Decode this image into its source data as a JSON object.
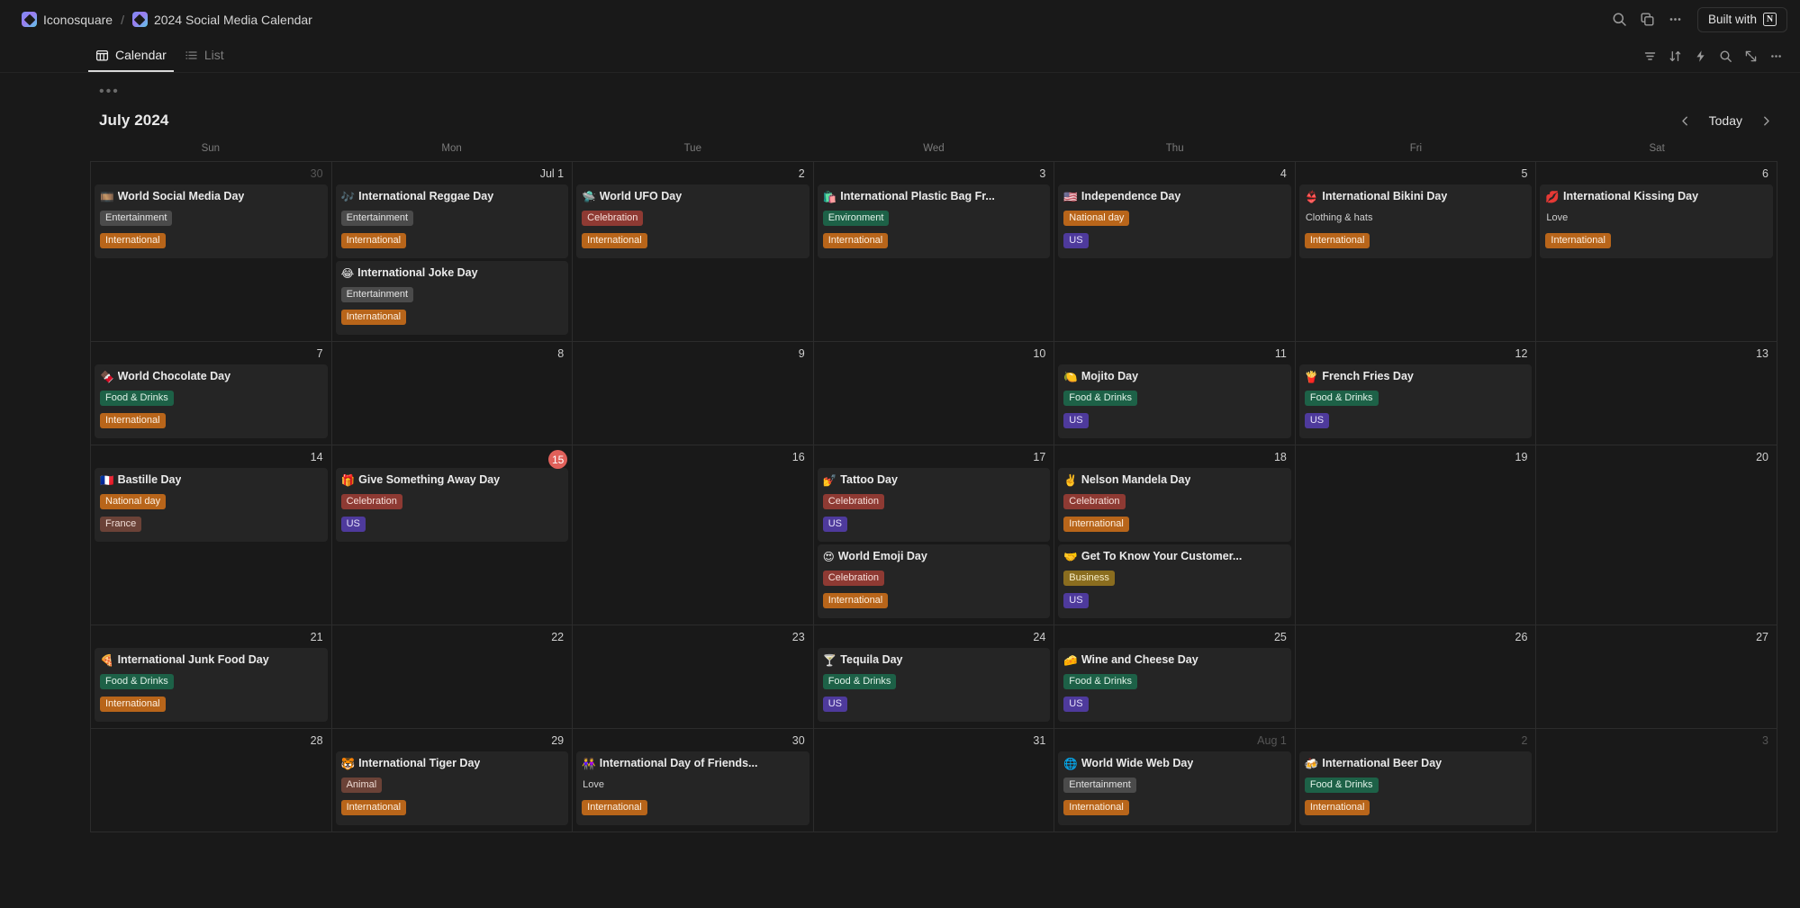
{
  "topbar": {
    "breadcrumb": [
      {
        "label": "Iconosquare",
        "icon": "iconosquare-logo"
      },
      {
        "label": "2024 Social Media Calendar",
        "icon": "iconosquare-logo"
      }
    ],
    "separator": "/",
    "actions": [
      {
        "name": "search-icon",
        "label": "Search"
      },
      {
        "name": "duplicate-icon",
        "label": "Duplicate"
      },
      {
        "name": "more-options-icon",
        "label": "More"
      }
    ],
    "built_with_label": "Built with",
    "built_with_brand": "N"
  },
  "view_tabs": [
    {
      "label": "Calendar",
      "icon": "calendar-icon",
      "active": true
    },
    {
      "label": "List",
      "icon": "list-icon",
      "active": false
    }
  ],
  "view_toolbar": [
    {
      "name": "filter-icon"
    },
    {
      "name": "sort-icon"
    },
    {
      "name": "automation-icon"
    },
    {
      "name": "search-icon"
    },
    {
      "name": "collapse-icon"
    },
    {
      "name": "more-options-icon"
    }
  ],
  "block_menu": "•••",
  "calendar": {
    "month_title": "July 2024",
    "today_label": "Today",
    "prev_label": "‹",
    "next_label": "›",
    "weekdays": [
      "Sun",
      "Mon",
      "Tue",
      "Wed",
      "Thu",
      "Fri",
      "Sat"
    ],
    "weeks": [
      [
        {
          "num": "30",
          "out": true,
          "events": [
            {
              "emoji": "🎞️",
              "title": "World Social Media Day",
              "tags": [
                {
                  "label": "Entertainment",
                  "color": "gray"
                },
                {
                  "label": "International",
                  "color": "orange"
                }
              ]
            }
          ]
        },
        {
          "num": "Jul 1",
          "out": false,
          "events": [
            {
              "emoji": "🎶",
              "title": "International Reggae Day",
              "tags": [
                {
                  "label": "Entertainment",
                  "color": "gray"
                },
                {
                  "label": "International",
                  "color": "orange"
                }
              ]
            },
            {
              "emoji": "😂",
              "title": "International Joke Day",
              "tags": [
                {
                  "label": "Entertainment",
                  "color": "gray"
                },
                {
                  "label": "International",
                  "color": "orange"
                }
              ]
            }
          ]
        },
        {
          "num": "2",
          "out": false,
          "events": [
            {
              "emoji": "🛸",
              "title": "World UFO Day",
              "tags": [
                {
                  "label": "Celebration",
                  "color": "red"
                },
                {
                  "label": "International",
                  "color": "orange"
                }
              ]
            }
          ]
        },
        {
          "num": "3",
          "out": false,
          "events": [
            {
              "emoji": "🛍️",
              "title": "International Plastic Bag Fr...",
              "tags": [
                {
                  "label": "Environment",
                  "color": "green"
                },
                {
                  "label": "International",
                  "color": "orange"
                }
              ]
            }
          ]
        },
        {
          "num": "4",
          "out": false,
          "events": [
            {
              "emoji": "🇺🇸",
              "title": "Independence Day",
              "tags": [
                {
                  "label": "National day",
                  "color": "orange"
                },
                {
                  "label": "US",
                  "color": "purple"
                }
              ]
            }
          ]
        },
        {
          "num": "5",
          "out": false,
          "events": [
            {
              "emoji": "👙",
              "title": "International Bikini Day",
              "tags": [
                {
                  "label": "Clothing & hats",
                  "color": "default"
                },
                {
                  "label": "International",
                  "color": "orange"
                }
              ]
            }
          ]
        },
        {
          "num": "6",
          "out": false,
          "events": [
            {
              "emoji": "💋",
              "title": "International Kissing Day",
              "tags": [
                {
                  "label": "Love",
                  "color": "default"
                },
                {
                  "label": "International",
                  "color": "orange"
                }
              ]
            }
          ]
        }
      ],
      [
        {
          "num": "7",
          "out": false,
          "events": [
            {
              "emoji": "🍫",
              "title": "World Chocolate Day",
              "tags": [
                {
                  "label": "Food & Drinks",
                  "color": "green"
                },
                {
                  "label": "International",
                  "color": "orange"
                }
              ]
            }
          ]
        },
        {
          "num": "8",
          "out": false,
          "events": []
        },
        {
          "num": "9",
          "out": false,
          "events": []
        },
        {
          "num": "10",
          "out": false,
          "events": []
        },
        {
          "num": "11",
          "out": false,
          "events": [
            {
              "emoji": "🍋",
              "title": "Mojito Day",
              "tags": [
                {
                  "label": "Food & Drinks",
                  "color": "green"
                },
                {
                  "label": "US",
                  "color": "purple"
                }
              ]
            }
          ]
        },
        {
          "num": "12",
          "out": false,
          "events": [
            {
              "emoji": "🍟",
              "title": "French Fries Day",
              "tags": [
                {
                  "label": "Food & Drinks",
                  "color": "green"
                },
                {
                  "label": "US",
                  "color": "purple"
                }
              ]
            }
          ]
        },
        {
          "num": "13",
          "out": false,
          "events": []
        }
      ],
      [
        {
          "num": "14",
          "out": false,
          "events": [
            {
              "emoji": "🇫🇷",
              "title": "Bastille Day",
              "tags": [
                {
                  "label": "National day",
                  "color": "orange"
                },
                {
                  "label": "France",
                  "color": "brown"
                }
              ]
            }
          ]
        },
        {
          "num": "15",
          "out": false,
          "today": true,
          "events": [
            {
              "emoji": "🎁",
              "title": "Give Something Away Day",
              "tags": [
                {
                  "label": "Celebration",
                  "color": "red"
                },
                {
                  "label": "US",
                  "color": "purple"
                }
              ]
            }
          ]
        },
        {
          "num": "16",
          "out": false,
          "events": []
        },
        {
          "num": "17",
          "out": false,
          "events": [
            {
              "emoji": "💅",
              "title": "Tattoo Day",
              "tags": [
                {
                  "label": "Celebration",
                  "color": "red"
                },
                {
                  "label": "US",
                  "color": "purple"
                }
              ]
            },
            {
              "emoji": "😍",
              "title": "World Emoji Day",
              "tags": [
                {
                  "label": "Celebration",
                  "color": "red"
                },
                {
                  "label": "International",
                  "color": "orange"
                }
              ]
            }
          ]
        },
        {
          "num": "18",
          "out": false,
          "events": [
            {
              "emoji": "✌️",
              "title": "Nelson Mandela Day",
              "tags": [
                {
                  "label": "Celebration",
                  "color": "red"
                },
                {
                  "label": "International",
                  "color": "orange"
                }
              ]
            },
            {
              "emoji": "🤝",
              "title": "Get To Know Your Customer...",
              "tags": [
                {
                  "label": "Business",
                  "color": "yellow"
                },
                {
                  "label": "US",
                  "color": "purple"
                }
              ]
            }
          ]
        },
        {
          "num": "19",
          "out": false,
          "events": []
        },
        {
          "num": "20",
          "out": false,
          "events": []
        }
      ],
      [
        {
          "num": "21",
          "out": false,
          "events": [
            {
              "emoji": "🍕",
              "title": "International Junk Food Day",
              "tags": [
                {
                  "label": "Food & Drinks",
                  "color": "green"
                },
                {
                  "label": "International",
                  "color": "orange"
                }
              ]
            }
          ]
        },
        {
          "num": "22",
          "out": false,
          "events": []
        },
        {
          "num": "23",
          "out": false,
          "events": []
        },
        {
          "num": "24",
          "out": false,
          "events": [
            {
              "emoji": "🍸",
              "title": "Tequila Day",
              "tags": [
                {
                  "label": "Food & Drinks",
                  "color": "green"
                },
                {
                  "label": "US",
                  "color": "purple"
                }
              ]
            }
          ]
        },
        {
          "num": "25",
          "out": false,
          "events": [
            {
              "emoji": "🧀",
              "title": "Wine and Cheese Day",
              "tags": [
                {
                  "label": "Food & Drinks",
                  "color": "green"
                },
                {
                  "label": "US",
                  "color": "purple"
                }
              ]
            }
          ]
        },
        {
          "num": "26",
          "out": false,
          "events": []
        },
        {
          "num": "27",
          "out": false,
          "events": []
        }
      ],
      [
        {
          "num": "28",
          "out": false,
          "events": []
        },
        {
          "num": "29",
          "out": false,
          "events": [
            {
              "emoji": "🐯",
              "title": "International Tiger Day",
              "tags": [
                {
                  "label": "Animal",
                  "color": "brown"
                },
                {
                  "label": "International",
                  "color": "orange"
                }
              ]
            }
          ]
        },
        {
          "num": "30",
          "out": false,
          "events": [
            {
              "emoji": "👭",
              "title": "International Day of Friends...",
              "tags": [
                {
                  "label": "Love",
                  "color": "default"
                },
                {
                  "label": "International",
                  "color": "orange"
                }
              ]
            }
          ]
        },
        {
          "num": "31",
          "out": false,
          "events": []
        },
        {
          "num": "Aug 1",
          "out": true,
          "events": [
            {
              "emoji": "🌐",
              "title": "World Wide Web Day",
              "tags": [
                {
                  "label": "Entertainment",
                  "color": "gray"
                },
                {
                  "label": "International",
                  "color": "orange"
                }
              ]
            }
          ]
        },
        {
          "num": "2",
          "out": true,
          "events": [
            {
              "emoji": "🍻",
              "title": "International Beer Day",
              "tags": [
                {
                  "label": "Food & Drinks",
                  "color": "green"
                },
                {
                  "label": "International",
                  "color": "orange"
                }
              ]
            }
          ]
        },
        {
          "num": "3",
          "out": true,
          "events": []
        }
      ]
    ]
  }
}
